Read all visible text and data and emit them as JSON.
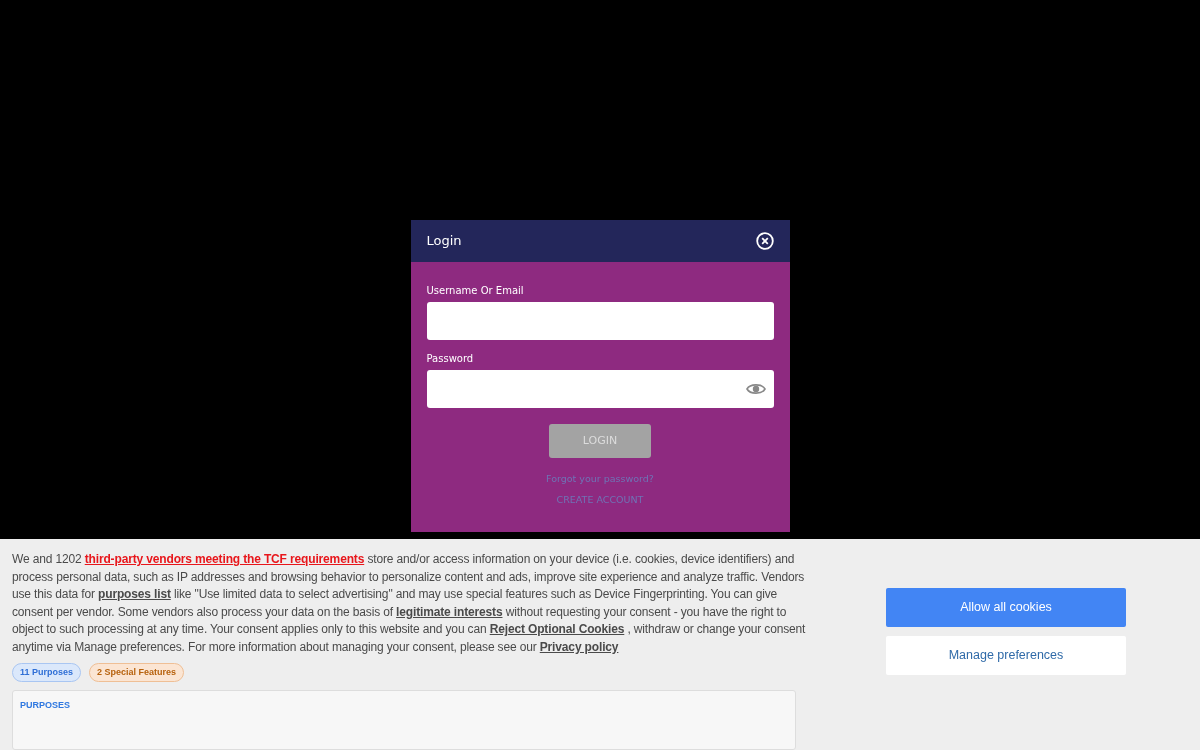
{
  "login_dialog": {
    "title": "Login",
    "fields": [
      {
        "label": "Username Or Email",
        "kind": "text"
      },
      {
        "label": "Password",
        "kind": "password"
      }
    ],
    "login_button": {
      "label": "LOGIN",
      "disabled": true
    },
    "links": [
      "Forgot your password?",
      "CREATE ACCOUNT"
    ]
  },
  "cookie_banner": {
    "text": [
      {
        "kind": "plain",
        "text": "We and 1202 "
      },
      {
        "kind": "vendor-link",
        "text": "third-party vendors meeting the TCF requirements"
      },
      {
        "kind": "plain",
        "text": " store and/or access information on your device (i.e. cookies, device identifiers) and process personal data, such as IP addresses and browsing behavior to personalize content and ads, improve site experience and analyze traffic. Vendors use this data for "
      },
      {
        "kind": "link",
        "text": "purposes list"
      },
      {
        "kind": "plain",
        "text": "  like \"Use limited data to select advertising\" and may use special features such as Device Fingerprinting. You can give consent per vendor. Some vendors also process your data on the basis of "
      },
      {
        "kind": "link",
        "text": "legitimate interests"
      },
      {
        "kind": "plain",
        "text": "  without requesting your consent - you have the right to object to such processing at any time. Your consent applies only to this website and you can "
      },
      {
        "kind": "link",
        "text": "Reject Optional Cookies"
      },
      {
        "kind": "plain",
        "text": " , withdraw or change your consent anytime via Manage preferences. For more information about managing your consent, please see our "
      },
      {
        "kind": "link",
        "text": "Privacy policy"
      }
    ],
    "tags": [
      {
        "label": "11 Purposes",
        "kind": "purposes"
      },
      {
        "label": "2 Special Features",
        "kind": "features"
      }
    ],
    "purposes_panel": {
      "title": "PURPOSES"
    },
    "buttons": [
      {
        "label": "Allow all cookies",
        "kind": "primary"
      },
      {
        "label": "Manage preferences",
        "kind": "secondary"
      }
    ]
  }
}
